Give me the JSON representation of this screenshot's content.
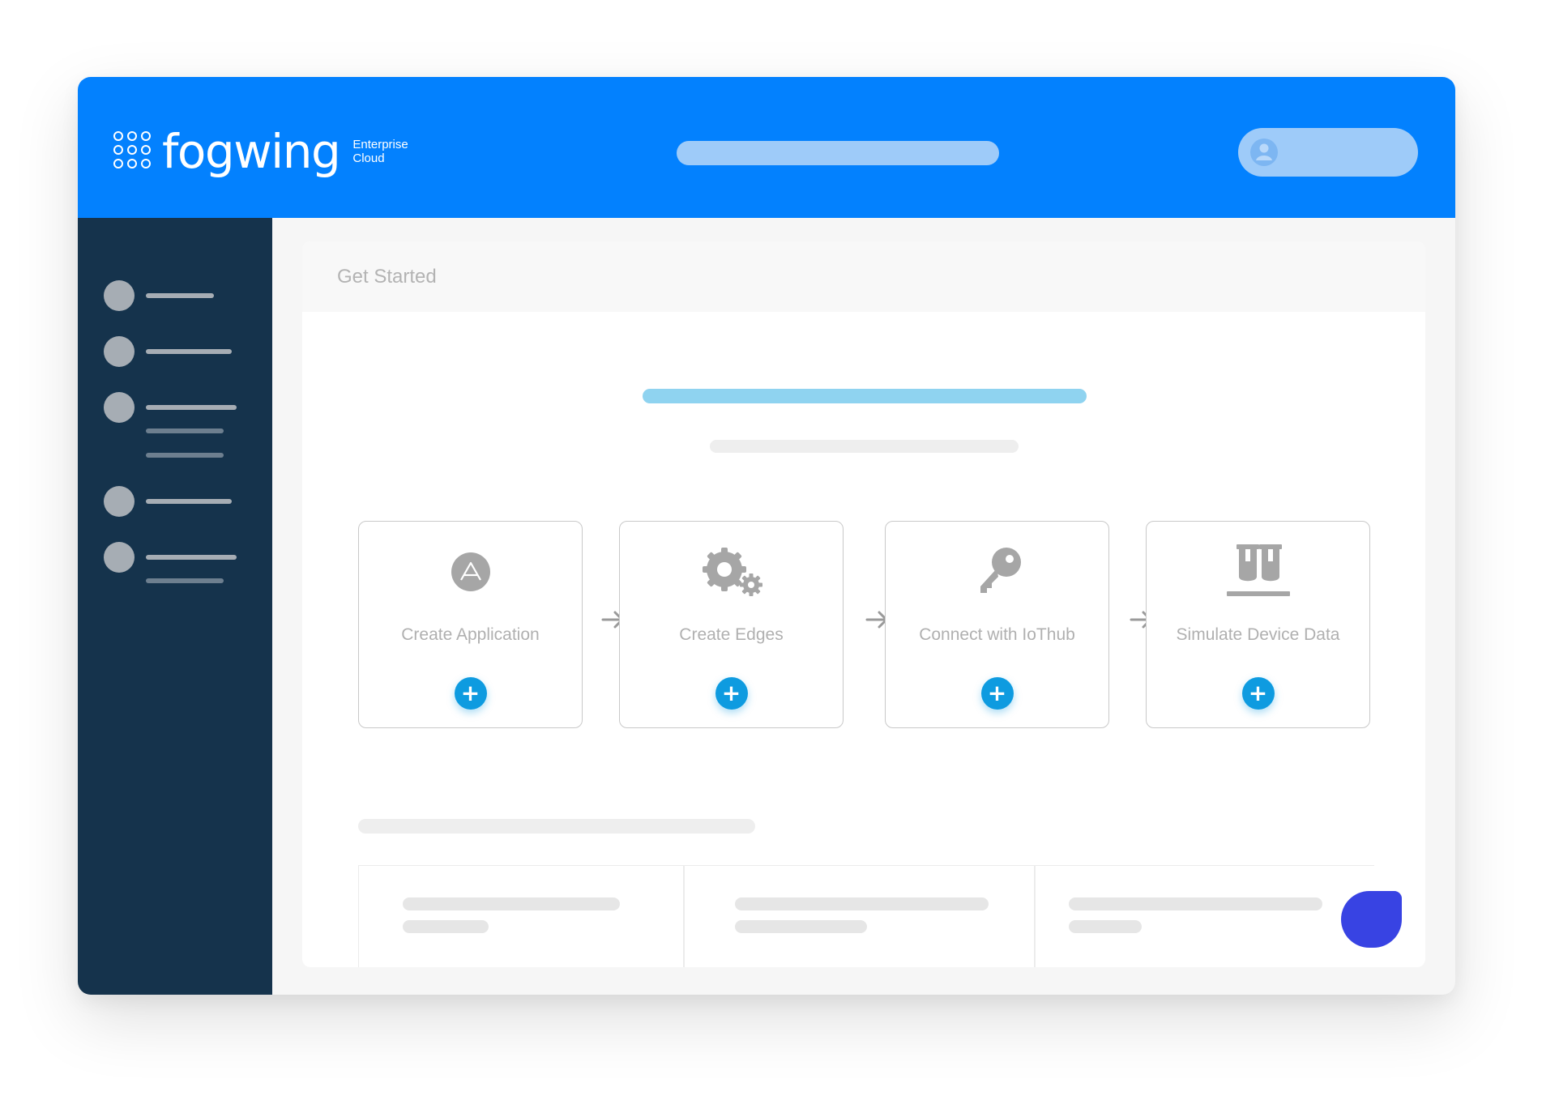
{
  "header": {
    "brand": "fogwing",
    "brand_sub_line1": "Enterprise",
    "brand_sub_line2": "Cloud",
    "brand_color": "#0381fe"
  },
  "sidebar": {
    "background": "#15334c"
  },
  "main": {
    "title": "Get Started",
    "steps": [
      {
        "label": "Create Application",
        "icon": "app-icon"
      },
      {
        "label": "Create Edges",
        "icon": "gears-icon"
      },
      {
        "label": "Connect with IoThub",
        "icon": "key-icon"
      },
      {
        "label": "Simulate Device Data",
        "icon": "test-tubes-icon"
      }
    ],
    "add_symbol": "+",
    "accent": "#0e9be0"
  },
  "chat": {
    "icon": "chat-bubble-icon",
    "color": "#3843e3"
  }
}
